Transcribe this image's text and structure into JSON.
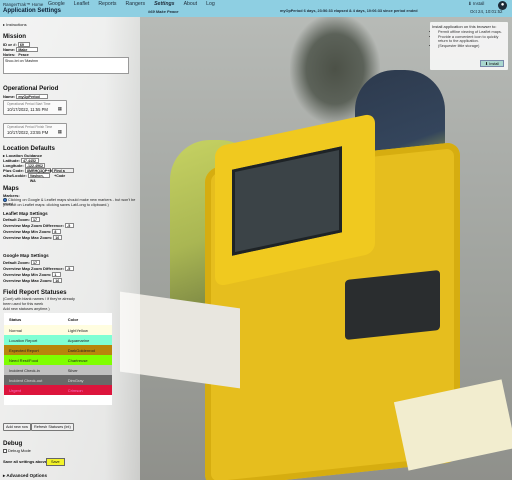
{
  "header": {
    "brand": "RangerTrak™ Home",
    "app_title": "Application Settings",
    "nav": [
      "Google",
      "Leaflet",
      "Reports",
      "Rangers",
      "Settings",
      "About",
      "Log"
    ],
    "active_nav": "Settings",
    "mission_badge": "#69 Make Peace",
    "period_status": "myOpPeriod 6 days, 23:56:33 elapsed & 4 days, 10:06:33 since period ended",
    "install_label": "Install",
    "clock": "Oct 24, 10:01:52"
  },
  "instructions": "Instructions",
  "mission": {
    "heading": "Mission",
    "id_label": "ID or #:",
    "id_value": "69",
    "name_label": "Name:",
    "name_value": "Make Peace",
    "notes_label": "Notes:",
    "notes_value": "Shoo-bri on 'Mashnn"
  },
  "op_period": {
    "heading": "Operational Period",
    "name_label": "Name:",
    "name_value": "myOpPeriod",
    "start_caption": "Operational Period Start Time",
    "start_value": "10/17/2022, 11:55 PM",
    "end_caption": "Operational Period Finish Time",
    "end_value": "10/17/2022, 23:55 PM"
  },
  "location": {
    "heading": "Location Defaults",
    "guidance": "Location Guidance",
    "lat_label": "Latitude:",
    "lat_value": "47.4452",
    "lng_label": "Longitude:",
    "lng_value": "-122.4962",
    "plus_label": "Plus Code:",
    "plus_value": "8MRHQ3QP+9Q",
    "find_label": "Find a +Code",
    "w3w_label": "w3w/Lookie:",
    "w3w_value": "Vashon, WA"
  },
  "maps": {
    "heading": "Maps",
    "markers_label": "Markers:",
    "markers_text": "Clicking on Google & Leaflet maps should make new markers - but won't be saved.",
    "markers_note": "(Default on Leaflet maps: clicking saves Lat/Long to clipboard.)",
    "leaflet_heading": "Leaflet Map Settings",
    "google_heading": "Google Map Settings",
    "leaflet_rows": [
      {
        "label": "Default Zoom:",
        "value": "17"
      },
      {
        "label": "Overview Map Zoom Difference:",
        "value": "-5"
      },
      {
        "label": "Overview Map Min Zoom:",
        "value": "8"
      },
      {
        "label": "Overview Map Max Zoom:",
        "value": "16"
      }
    ],
    "google_rows": [
      {
        "label": "Default Zoom:",
        "value": "17"
      },
      {
        "label": "Overview Map Zoom Difference:",
        "value": "-5"
      },
      {
        "label": "Overview Map Min Zoom:",
        "value": "1"
      },
      {
        "label": "Overview Map Max Zoom:",
        "value": "16"
      }
    ]
  },
  "statuses": {
    "heading": "Field Report Statuses",
    "note1": "(Cont) with blank names / if they're already",
    "note2": "been used for this week",
    "note3": "Add new statuses anytime.)",
    "col_status": "Status",
    "col_color": "Color",
    "rows": [
      {
        "status": "Normal",
        "color": "LightYellow",
        "bg": "#fffde0",
        "fg": "#222"
      },
      {
        "status": "Location Report",
        "color": "Aquamarine",
        "bg": "#7fffd4",
        "fg": "#222"
      },
      {
        "status": "Expected Report",
        "color": "DarkGoldenrod",
        "bg": "#b8860b",
        "fg": "#222"
      },
      {
        "status": "Need Rest/Food",
        "color": "Chartreuse",
        "bg": "#7fff00",
        "fg": "#222"
      },
      {
        "status": "Incident Check-in",
        "color": "Silver",
        "bg": "#c0c0c0",
        "fg": "#222"
      },
      {
        "status": "Incident Check-out",
        "color": "DimGray",
        "bg": "#696969",
        "fg": "#ddd"
      },
      {
        "status": "Urgent",
        "color": "Crimson",
        "bg": "#dc143c",
        "fg": "#f7c"
      },
      {
        "status": "",
        "color": "",
        "bg": "#ffffff",
        "fg": "#222"
      }
    ],
    "add_row": "Add new row",
    "refresh": "Refresh Statuses (lnt)"
  },
  "debug": {
    "heading": "Debug",
    "mode_label": "Debug Mode"
  },
  "save": {
    "label": "Save all settings above:",
    "button": "Save"
  },
  "advanced": "Advanced Options",
  "install_card": {
    "title": "Install application on this browser to:",
    "items": [
      "Permit offline viewing of Leaflet maps.",
      "Provide a convenient icon to quickly return to the application.",
      "(Sequester little storage)"
    ],
    "button": "Install"
  },
  "colors": {
    "topbar": "#8ecfe2",
    "save_button": "#f3f32a",
    "case": "#e6be1e"
  }
}
